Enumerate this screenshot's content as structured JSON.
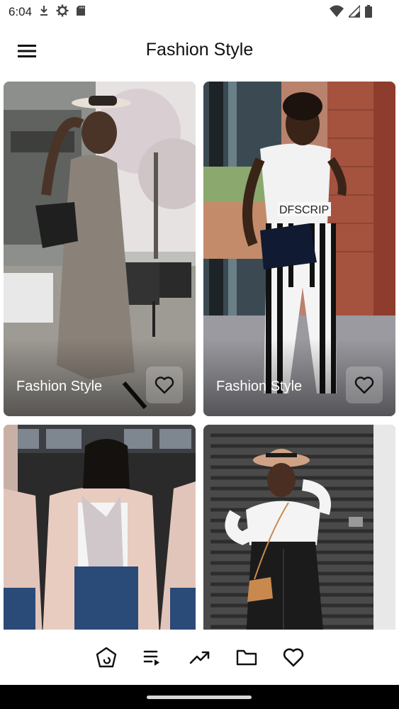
{
  "status_bar": {
    "time": "6:04",
    "left_icons": [
      "download-icon",
      "settings-icon",
      "sd-card-icon"
    ],
    "right_icons": [
      "wifi-icon",
      "signal-icon",
      "battery-icon"
    ]
  },
  "app_bar": {
    "title": "Fashion Style",
    "menu_icon": "menu-icon"
  },
  "cards": [
    {
      "label": "Fashion Style",
      "favorite_icon": "heart-outline-icon",
      "image": "woman-grey-jumpsuit-hat"
    },
    {
      "label": "Fashion Style",
      "favorite_icon": "heart-outline-icon",
      "image": "woman-white-tee-striped-pants"
    },
    {
      "label": "",
      "image": "woman-pink-blazer-scarf-glasses"
    },
    {
      "label": "",
      "image": "woman-white-top-leather-skirt-hat"
    }
  ],
  "bottom_nav": {
    "items": [
      "home-icon",
      "playlist-icon",
      "trending-icon",
      "folder-icon",
      "heart-outline-icon"
    ]
  },
  "colors": {
    "background": "#ffffff",
    "text": "#111111",
    "gesture_bar": "#000000"
  }
}
